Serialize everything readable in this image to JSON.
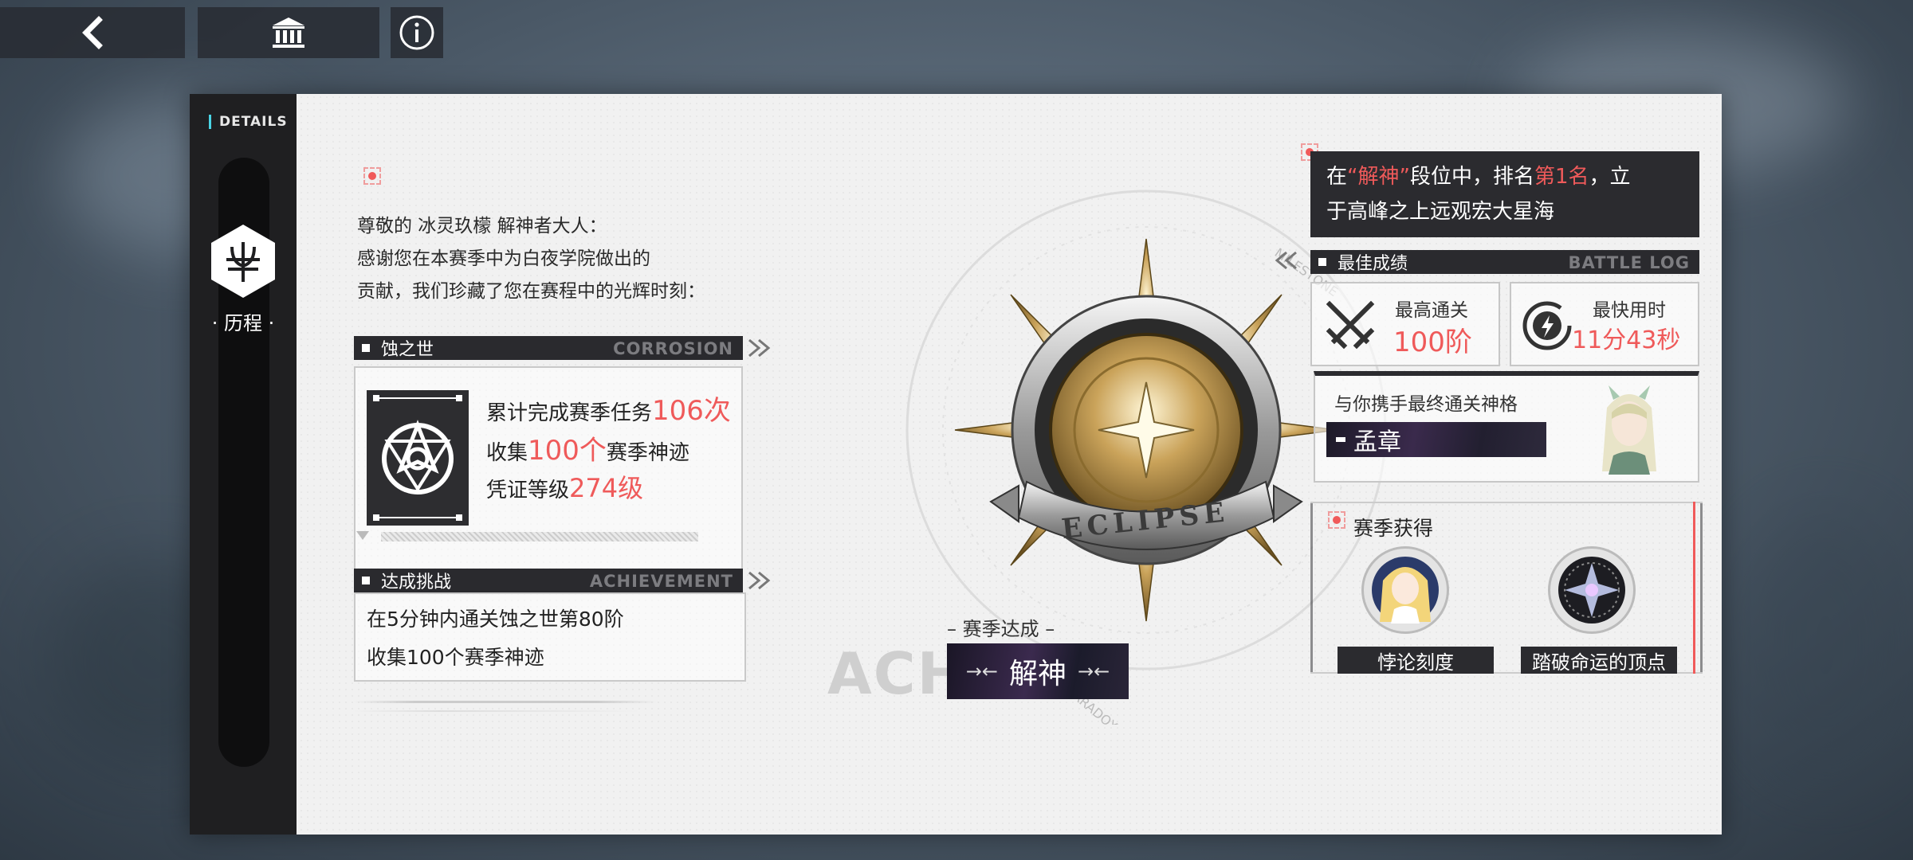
{
  "topbar": {
    "back_icon": "chevron-left-icon",
    "home_icon": "museum-icon",
    "info_icon": "info-circle-icon"
  },
  "sidebar": {
    "details_label": "DETAILS",
    "tab_label": "· 历程 ·"
  },
  "letter": {
    "line1": "尊敬的 冰灵玖檬 解神者大人：",
    "line2": " 感谢您在本赛季中为白夜学院做出的",
    "line3": "贡献，我们珍藏了您在赛程中的光辉时刻："
  },
  "corrosion": {
    "title": "蚀之世",
    "subtitle": "CORROSION",
    "stat1_prefix": "累计完成赛季任务",
    "stat1_value": "106次",
    "stat2_prefix": "收集",
    "stat2_value": "100个",
    "stat2_suffix": "赛季神迹",
    "stat3_prefix": "凭证等级",
    "stat3_value": "274级"
  },
  "achievement": {
    "title": "达成挑战",
    "subtitle": "ACHIEVEMENT",
    "line1": "在5分钟内通关蚀之世第80阶",
    "line2": "收集100个赛季神迹"
  },
  "center": {
    "season_title": "– 赛季达成 –",
    "ghost_text": "ACH           NT",
    "rank": "解神",
    "medal_text": "ECLIPSE",
    "ring_top": "MILESTONE",
    "ring_bottom": "PARADOX"
  },
  "rank_info": {
    "t1": "在",
    "t2": "“解神”",
    "t3": "段位中，排名",
    "t4": "第1名",
    "t5": "，立",
    "line2": "于高峰之上远观宏大星海"
  },
  "battle_log": {
    "title": "最佳成绩",
    "subtitle": "BATTLE LOG",
    "highest_label": "最高通关",
    "highest_value": "100阶",
    "fastest_label": "最快用时",
    "fastest_value": "11分43秒"
  },
  "partner": {
    "label": "与你携手最终通关神格",
    "name": "孟章"
  },
  "season_rewards": {
    "title": "赛季获得",
    "item1": "悖论刻度",
    "item2": "踏破命运的顶点"
  }
}
